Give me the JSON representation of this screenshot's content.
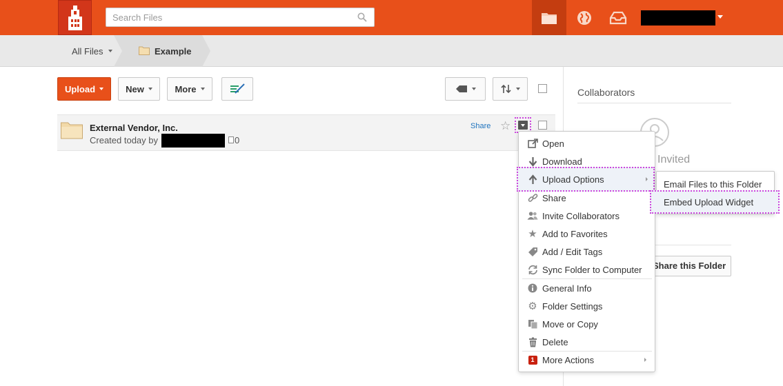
{
  "topbar": {
    "logo_name": "university-tower-logo",
    "search_placeholder": "Search Files",
    "nav_icons": [
      "folder-icon",
      "globe-icon",
      "inbox-icon"
    ],
    "accent_color": "#e8501a"
  },
  "breadcrumb": {
    "root": "All Files",
    "current": "Example"
  },
  "toolbar": {
    "upload_label": "Upload",
    "new_label": "New",
    "more_label": "More"
  },
  "items": [
    {
      "name": "External Vendor, Inc.",
      "meta": "Created today by",
      "count": "0",
      "share_label": "Share"
    }
  ],
  "context_menu": {
    "items": [
      {
        "label": "Open",
        "icon": "open-external-icon"
      },
      {
        "label": "Download",
        "icon": "download-arrow-icon"
      },
      {
        "label": "Upload Options",
        "icon": "upload-arrow-icon"
      },
      {
        "label": "Share",
        "icon": "link-icon"
      },
      {
        "label": "Invite Collaborators",
        "icon": "people-icon"
      },
      {
        "label": "Add to Favorites",
        "icon": "star-icon"
      },
      {
        "label": "Add / Edit Tags",
        "icon": "tag-icon"
      },
      {
        "label": "Sync Folder to Computer",
        "icon": "sync-icon"
      },
      {
        "label": "General Info",
        "icon": "info-icon"
      },
      {
        "label": "Folder Settings",
        "icon": "gear-icon"
      },
      {
        "label": "Move or Copy",
        "icon": "copy-icon"
      },
      {
        "label": "Delete",
        "icon": "trash-icon"
      },
      {
        "label": "More Actions",
        "icon": "badge-icon",
        "badge": "1"
      }
    ]
  },
  "submenu": {
    "items": [
      {
        "label": "Email Files to this Folder"
      },
      {
        "label": "Embed Upload Widget"
      }
    ]
  },
  "sidebar": {
    "title": "Collaborators",
    "invited": "Invited",
    "button_label": "Share this Folder"
  }
}
